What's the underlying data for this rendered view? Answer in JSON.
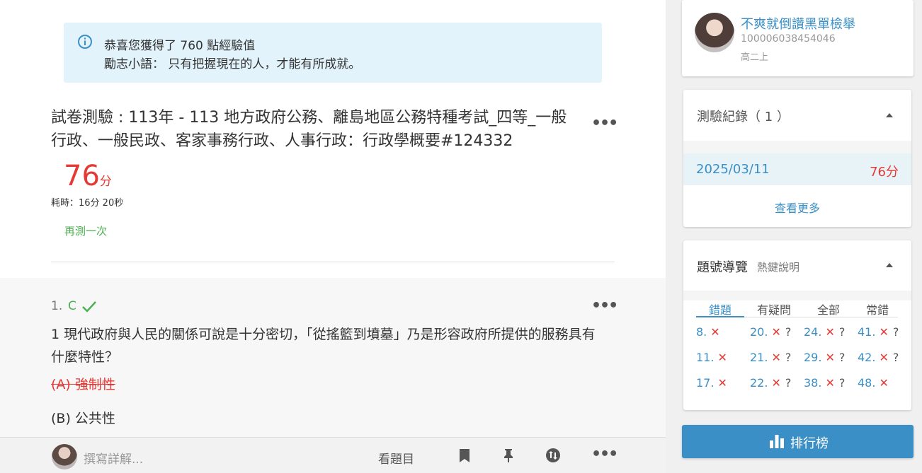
{
  "alert": {
    "line1": "恭喜您獲得了 760 點經驗值",
    "line2": "勵志小語： 只有把握現在的人，才能有所成就。"
  },
  "exam": {
    "title": "試卷測驗 : 113年 - 113 地方政府公務、離島地區公務特種考試_四等_一般行政、一般民政、客家事務行政、人事行政：行政學概要#124332",
    "score": "76",
    "score_unit": "分",
    "elapsed": "耗時：16分 20秒",
    "retry": "再測一次",
    "more": "•••"
  },
  "question": {
    "number": "1.",
    "answer": "C",
    "text": "1 現代政府與人民的關係可說是十分密切，「從搖籃到墳墓」乃是形容政府所提供的服務具有什麼特性？",
    "option_a": "(A) 強制性",
    "option_b": "(B) 公共性",
    "more": "•••"
  },
  "bottombar": {
    "write_placeholder": "撰寫詳解...",
    "view_question": "看題目",
    "more": "•••"
  },
  "profile": {
    "name": "不爽就倒讚黑單檢舉",
    "id": "100006038454046",
    "grade": "高二上"
  },
  "records": {
    "header": "測驗紀錄（ 1 ）",
    "items": [
      {
        "date": "2025/03/11",
        "score": "76分"
      }
    ],
    "see_more": "查看更多"
  },
  "nav": {
    "header": "題號導覽",
    "hint": "熱鍵說明",
    "tabs": [
      "錯題",
      "有疑問",
      "全部",
      "常錯"
    ],
    "active_tab": "錯題",
    "questions": [
      {
        "num": "8.",
        "mark": "✕",
        "doubt": ""
      },
      {
        "num": "20.",
        "mark": "✕",
        "doubt": "?"
      },
      {
        "num": "24.",
        "mark": "✕",
        "doubt": "?"
      },
      {
        "num": "41.",
        "mark": "✕",
        "doubt": "?"
      },
      {
        "num": "11.",
        "mark": "✕",
        "doubt": ""
      },
      {
        "num": "21.",
        "mark": "✕",
        "doubt": "?"
      },
      {
        "num": "29.",
        "mark": "✕",
        "doubt": "?"
      },
      {
        "num": "42.",
        "mark": "✕",
        "doubt": "?"
      },
      {
        "num": "17.",
        "mark": "✕",
        "doubt": ""
      },
      {
        "num": "22.",
        "mark": "✕",
        "doubt": "?"
      },
      {
        "num": "38.",
        "mark": "✕",
        "doubt": "?"
      },
      {
        "num": "48.",
        "mark": "✕",
        "doubt": ""
      }
    ]
  },
  "ranking_button": "排行榜",
  "colors": {
    "accent": "#3a8fc7",
    "wrong": "#e53935",
    "correct": "#4caf50",
    "alert_bg": "#e2f3fb"
  }
}
